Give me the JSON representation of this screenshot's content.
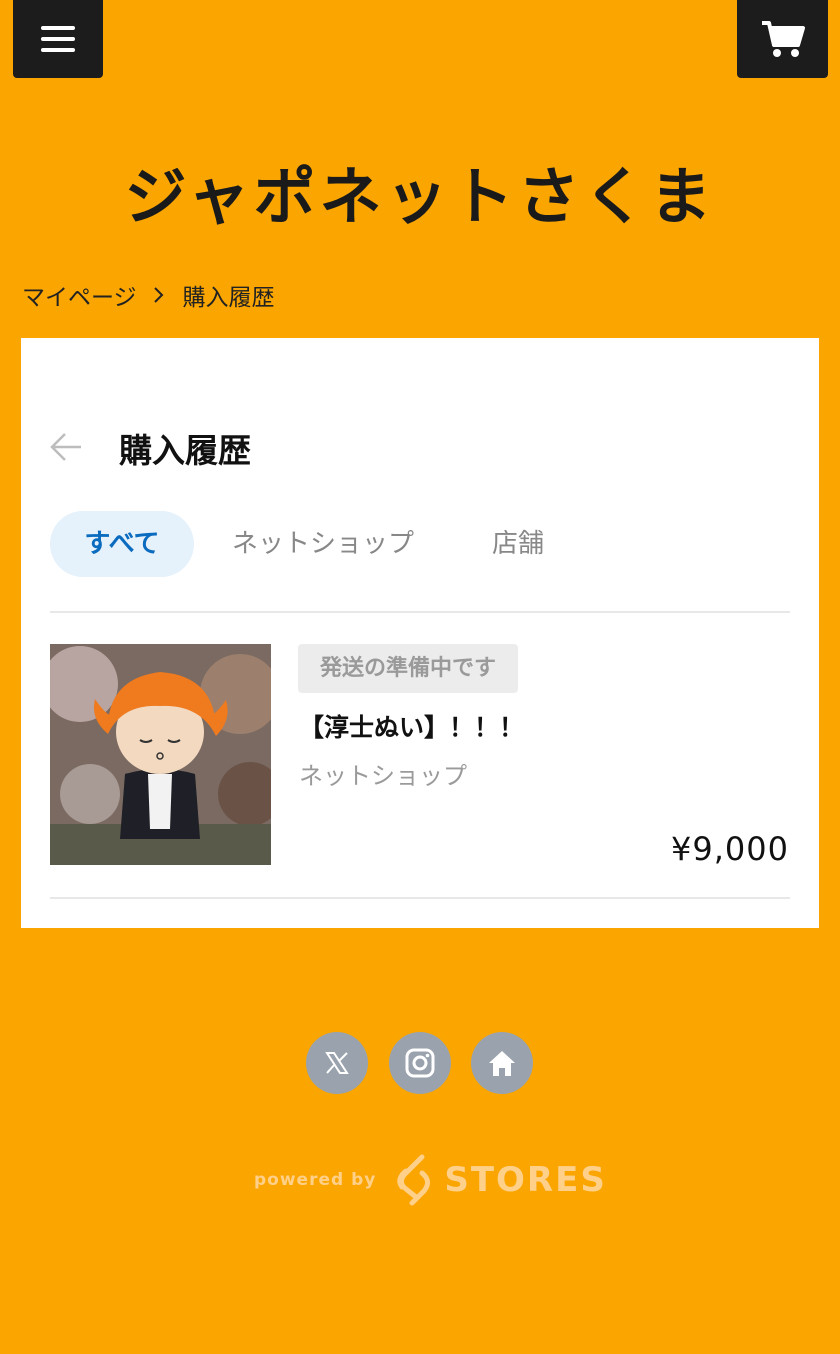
{
  "header": {
    "menu_icon": "hamburger-menu-icon",
    "cart_icon": "shopping-cart-icon",
    "shop_name": "ジャポネットさくま"
  },
  "breadcrumb": {
    "items": [
      "マイページ",
      "購入履歴"
    ],
    "separator_icon": "chevron-right-icon"
  },
  "page": {
    "back_icon": "arrow-left-icon",
    "title": "購入履歴",
    "tabs": [
      {
        "label": "すべて",
        "active": true
      },
      {
        "label": "ネットショップ",
        "active": false
      },
      {
        "label": "店舗",
        "active": false
      }
    ]
  },
  "orders": [
    {
      "status": "発送の準備中です",
      "product_name": "【淳士ぬい】！！！",
      "channel": "ネットショップ",
      "price": "¥9,000",
      "image_icon": "plush-doll-photo"
    }
  ],
  "footer": {
    "social": [
      {
        "icon": "x-logo-icon"
      },
      {
        "icon": "instagram-icon"
      },
      {
        "icon": "home-icon"
      }
    ],
    "powered_by": "powered by",
    "brand": "STORES"
  },
  "colors": {
    "background": "#FAA500",
    "header_buttons": "#1c1c1c",
    "active_tab_bg": "#E5F1FB",
    "active_tab_text": "#0a6bbf",
    "social_bg": "#9aa3ad"
  }
}
